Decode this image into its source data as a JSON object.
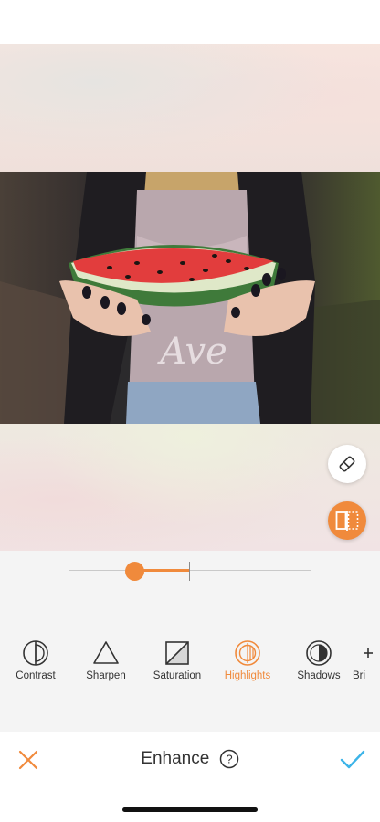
{
  "editor": {
    "title": "Enhance",
    "help_icon": "help-circle-icon",
    "cancel_icon": "close-icon",
    "confirm_icon": "check-icon",
    "accent_color": "#f08a3c",
    "confirm_color": "#3cb4e8"
  },
  "canvas": {
    "floating_buttons": [
      "eraser-icon",
      "compare-icon"
    ]
  },
  "slider": {
    "value_fraction": -0.45
  },
  "tools": [
    {
      "label": "Contrast",
      "icon": "contrast-icon",
      "active": false
    },
    {
      "label": "Sharpen",
      "icon": "triangle-icon",
      "active": false
    },
    {
      "label": "Saturation",
      "icon": "saturation-icon",
      "active": false
    },
    {
      "label": "Highlights",
      "icon": "highlights-icon",
      "active": true
    },
    {
      "label": "Shadows",
      "icon": "shadows-icon",
      "active": false
    },
    {
      "label": "Bri",
      "icon": "brightness-icon",
      "active": false
    }
  ]
}
